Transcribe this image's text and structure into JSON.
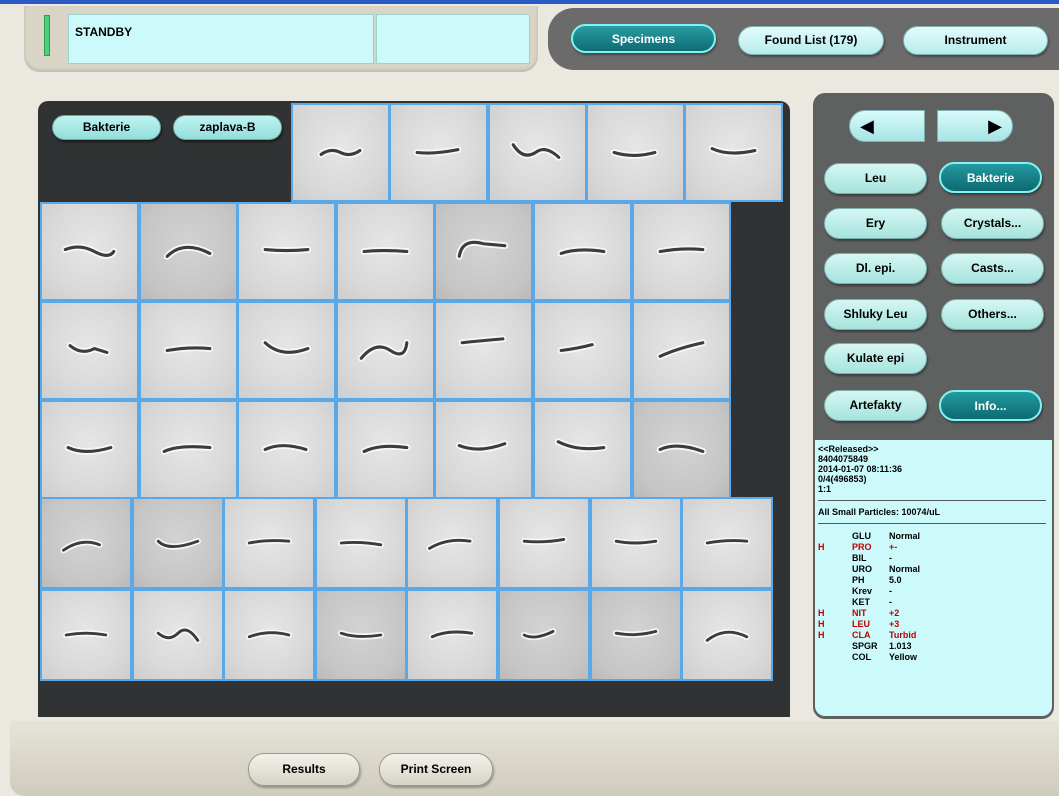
{
  "status": {
    "mode": "STANDBY",
    "secondary": ""
  },
  "nav": {
    "specimens": "Specimens",
    "found_list": "Found List (179)",
    "instrument": "Instrument"
  },
  "viewer": {
    "category_label": "Bakterie",
    "subcategory_label": "zaplava-B"
  },
  "categories": {
    "leu": "Leu",
    "bakterie": "Bakterie",
    "ery": "Ery",
    "crystals": "Crystals...",
    "dl_epi": "Dl. epi.",
    "casts": "Casts...",
    "shluky_leu": "Shluky Leu",
    "others": "Others...",
    "kulate_epi": "Kulate epi",
    "artefakty": "Artefakty",
    "info": "Info..."
  },
  "arrows": {
    "prev": "◀",
    "next": "▶"
  },
  "info": {
    "status": "<<Released>>",
    "sample_id": "8404075849",
    "datetime": "2014-01-07 08:11:36",
    "rack": "0/4(496853)",
    "dilution": "1:1",
    "particles": "All Small Particles: 10074/uL"
  },
  "urinalysis": [
    {
      "flag": "",
      "name": "GLU",
      "value": "Normal",
      "high": false
    },
    {
      "flag": "H",
      "name": "PRO",
      "value": "+-",
      "high": true
    },
    {
      "flag": "",
      "name": "BIL",
      "value": "-",
      "high": false
    },
    {
      "flag": "",
      "name": "URO",
      "value": "Normal",
      "high": false
    },
    {
      "flag": "",
      "name": "PH",
      "value": "5.0",
      "high": false
    },
    {
      "flag": "",
      "name": "Krev",
      "value": "-",
      "high": false
    },
    {
      "flag": "",
      "name": "KET",
      "value": "-",
      "high": false
    },
    {
      "flag": "H",
      "name": "NIT",
      "value": "+2",
      "high": true
    },
    {
      "flag": "H",
      "name": "LEU",
      "value": "+3",
      "high": true
    },
    {
      "flag": "H",
      "name": "CLA",
      "value": "Turbid",
      "high": true
    },
    {
      "flag": "",
      "name": "SPGR",
      "value": "1.013",
      "high": false
    },
    {
      "flag": "",
      "name": "COL",
      "value": "Yellow",
      "high": false
    }
  ],
  "bottom": {
    "results": "Results",
    "print_screen": "Print Screen"
  },
  "colors": {
    "accent_dark": "#0f6b73",
    "panel_light": "#ccfafa",
    "tile_border": "#5aa8e8",
    "high_flag": "#c00000"
  }
}
